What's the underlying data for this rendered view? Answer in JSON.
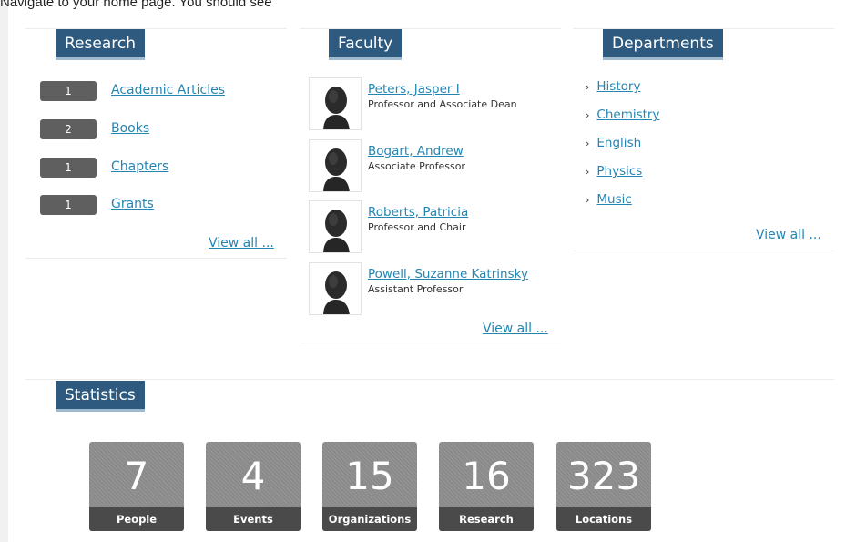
{
  "intro_text": "Navigate to your home page.  You should see",
  "research": {
    "heading": "Research",
    "items": [
      {
        "count": "1",
        "label": "Academic Articles"
      },
      {
        "count": "2",
        "label": "Books"
      },
      {
        "count": "1",
        "label": "Chapters"
      },
      {
        "count": "1",
        "label": "Grants"
      }
    ],
    "view_all": "View all ..."
  },
  "faculty": {
    "heading": "Faculty",
    "items": [
      {
        "name": "Peters, Jasper I",
        "title": "Professor and Associate Dean"
      },
      {
        "name": "Bogart, Andrew",
        "title": "Associate Professor"
      },
      {
        "name": "Roberts, Patricia",
        "title": "Professor and Chair"
      },
      {
        "name": "Powell, Suzanne Katrinsky",
        "title": "Assistant Professor"
      }
    ],
    "view_all": "View all ...",
    "thumb_icon": "person-silhouette-icon"
  },
  "departments": {
    "heading": "Departments",
    "items": [
      "History",
      "Chemistry",
      "English",
      "Physics",
      "Music"
    ],
    "chevron": "›",
    "chevron_icon": "chevron-right-icon",
    "view_all": "View all ..."
  },
  "statistics": {
    "heading": "Statistics",
    "items": [
      {
        "value": "7",
        "label": "People"
      },
      {
        "value": "4",
        "label": "Events"
      },
      {
        "value": "15",
        "label": "Organizations"
      },
      {
        "value": "16",
        "label": "Research"
      },
      {
        "value": "323",
        "label": "Locations"
      }
    ]
  },
  "colors": {
    "heading_bg": "#2d5a7e",
    "link": "#2485b3",
    "badge": "#5f5f5f",
    "stat_tile": "#8a8a8a",
    "stat_label_bar": "#4a4a4a"
  }
}
